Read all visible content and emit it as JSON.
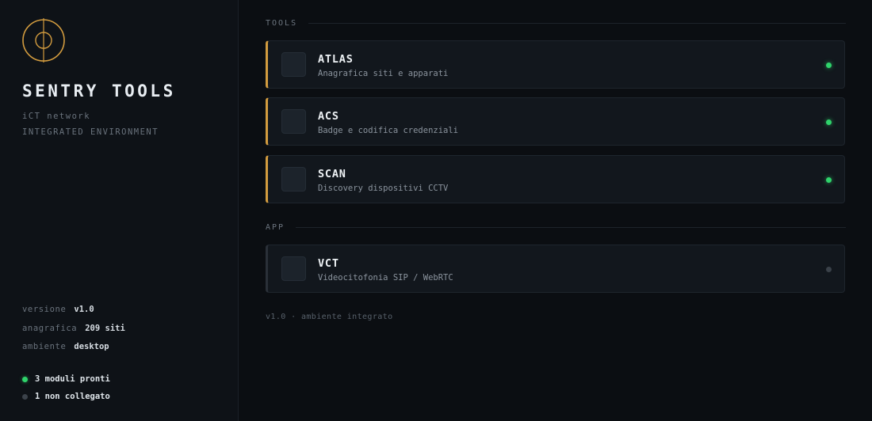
{
  "sidebar": {
    "title": "SENTRY TOOLS",
    "subtitle_line1": "iCT network",
    "subtitle_line2": "INTEGRATED ENVIRONMENT",
    "meta": [
      {
        "key": "versione",
        "value": "v1.0"
      },
      {
        "key": "anagrafica",
        "value": "209 siti"
      },
      {
        "key": "ambiente",
        "value": "desktop"
      }
    ],
    "status": [
      {
        "label": "3 moduli pronti",
        "state": "on"
      },
      {
        "label": "1 non collegato",
        "state": "off"
      }
    ]
  },
  "main": {
    "tools_heading": "TOOLS",
    "tools": [
      {
        "title": "ATLAS",
        "description": "Anagrafica siti e apparati",
        "status": "online"
      },
      {
        "title": "ACS",
        "description": "Badge e codifica credenziali",
        "status": "online"
      },
      {
        "title": "SCAN",
        "description": "Discovery dispositivi CCTV",
        "status": "online"
      }
    ],
    "app_heading": "APP",
    "apps": [
      {
        "title": "VCT",
        "description": "Videocitofonia SIP / WebRTC",
        "status": "offline"
      }
    ],
    "footer": "v1.0 · ambiente integrato"
  },
  "colors": {
    "accent": "#d39c3f",
    "online": "#2fd36b",
    "offline": "#3a4149",
    "background": "#0b0e12"
  },
  "icons": {
    "logo": "crosshair-circle-icon"
  }
}
